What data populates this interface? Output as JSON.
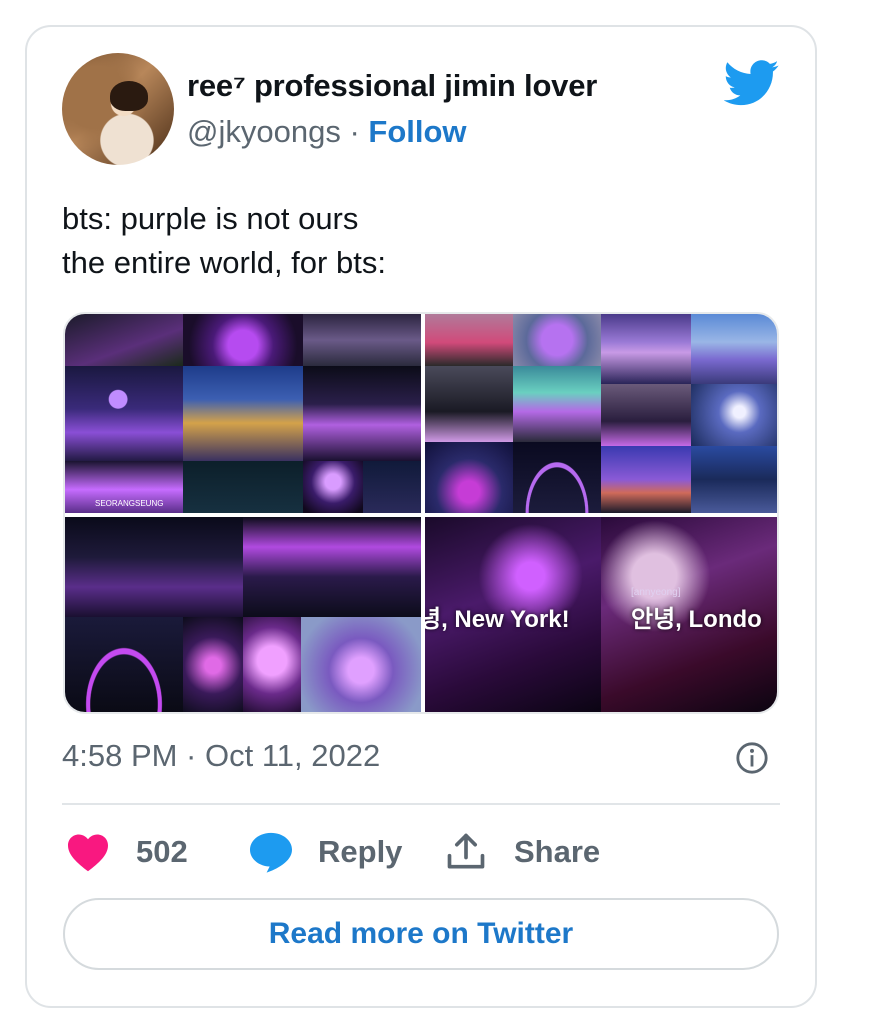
{
  "tweet": {
    "author_name": "ree⁷ professional jimin lover",
    "handle": "@jkyoongs",
    "separator": " · ",
    "follow_label": "Follow",
    "text_line_1": "bts: purple is not ours",
    "text_line_2": "the entire world, for bts:",
    "media_captions": {
      "new_york": "녕, New York!",
      "london": "안녕, Londo",
      "small_label": "[annyeong]",
      "billboard": "SEORANGSEUNG"
    },
    "timestamp": "4:58 PM · Oct 11, 2022",
    "like_count": "502",
    "reply_label": "Reply",
    "share_label": "Share",
    "read_more_label": "Read more on Twitter"
  },
  "colors": {
    "brand_blue": "#1d9bf0",
    "link_blue": "#1d78c9",
    "heart_pink": "#f91880",
    "muted_text": "#5b6670"
  },
  "icons": {
    "brand": "twitter-bird-icon",
    "info": "info-icon",
    "like": "heart-icon",
    "reply": "speech-bubble-icon",
    "share": "share-upload-icon"
  }
}
